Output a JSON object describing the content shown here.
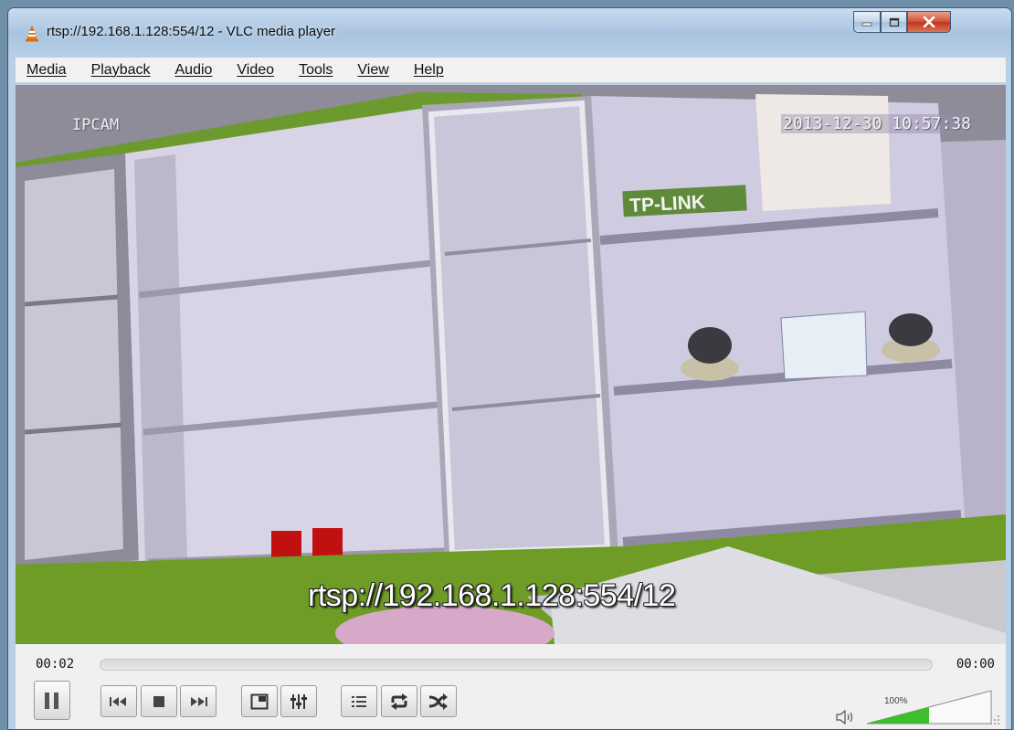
{
  "window": {
    "title": "rtsp://192.168.1.128:554/12 - VLC media player",
    "app_icon": "vlc-cone-icon",
    "buttons": [
      "minimize-icon",
      "maximize-icon",
      "close-icon"
    ]
  },
  "menubar": {
    "items": [
      {
        "label": "Media"
      },
      {
        "label": "Playback"
      },
      {
        "label": "Audio"
      },
      {
        "label": "Video"
      },
      {
        "label": "Tools"
      },
      {
        "label": "View"
      },
      {
        "label": "Help"
      }
    ]
  },
  "video": {
    "osd_camera_label": "IPCAM",
    "osd_timestamp": "2013-12-30 10:57:38",
    "osd_stream_url": "rtsp://192.168.1.128:554/12",
    "scene_brand_sign": "TP-LINK"
  },
  "controls": {
    "time_elapsed": "00:02",
    "time_total": "00:00",
    "seek_position": 0,
    "volume_label": "100%",
    "volume_level": 0.5,
    "buttons": [
      "pause-icon",
      "previous-icon",
      "stop-icon",
      "next-icon",
      "fullscreen-icon",
      "extended-settings-icon",
      "playlist-icon",
      "loop-icon",
      "shuffle-icon",
      "volume-icon"
    ]
  },
  "colors": {
    "accent_volume": "#3cbf2a",
    "titlebar": "#b9cfe6",
    "close_button": "#c8402a"
  }
}
